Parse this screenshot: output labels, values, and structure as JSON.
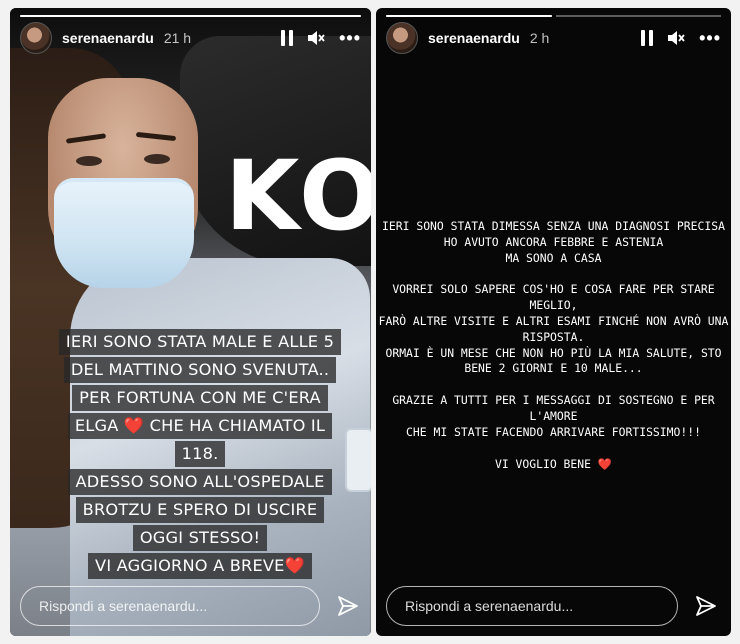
{
  "stories": [
    {
      "username": "serenaenardu",
      "time": "21 h",
      "overlay_big_text": "KO",
      "caption_lines": [
        "Ieri sono stata male e alle 5",
        "del mattino sono svenuta..",
        "Per fortuna con me c'era",
        "Elga ❤️ che ha chiamato il",
        "118.",
        "Adesso sono all'ospedale",
        "Brotzu e spero di uscire",
        "oggi stesso!",
        "Vi aggiorno a breve❤️"
      ],
      "reply_placeholder": "Rispondi a serenaenardu...",
      "progress": 1.0
    },
    {
      "username": "serenaenardu",
      "time": "2 h",
      "paragraphs": [
        [
          "Ieri sono stata dimessa senza una diagnosi precisa",
          "ho avuto ancora febbre e astenia",
          "ma sono a casa"
        ],
        [
          "Vorrei solo sapere cos'ho e cosa fare per  stare",
          "meglio,",
          "farò altre visite e altri esami finché non avrò una",
          "risposta.",
          "Ormai è un mese che non ho più la mia salute, sto",
          "bene 2 giorni e 10 male..."
        ],
        [
          "Grazie a tutti per i messaggi di sostegno e per l'amore",
          "che mi state facendo arrivare fortissimo!!!"
        ],
        [
          "Vi voglio bene ❤️"
        ]
      ],
      "reply_placeholder": "Rispondi a serenaenardu...",
      "progress_segments": [
        1.0,
        0.0
      ]
    }
  ],
  "icons": {
    "pause": "pause-icon",
    "mute": "speaker-muted-icon",
    "more": "more-options-icon",
    "send": "send-paper-plane-icon"
  },
  "colors": {
    "story_bg": "#070707",
    "text": "#ffffff",
    "caption_bg": "#282828"
  }
}
